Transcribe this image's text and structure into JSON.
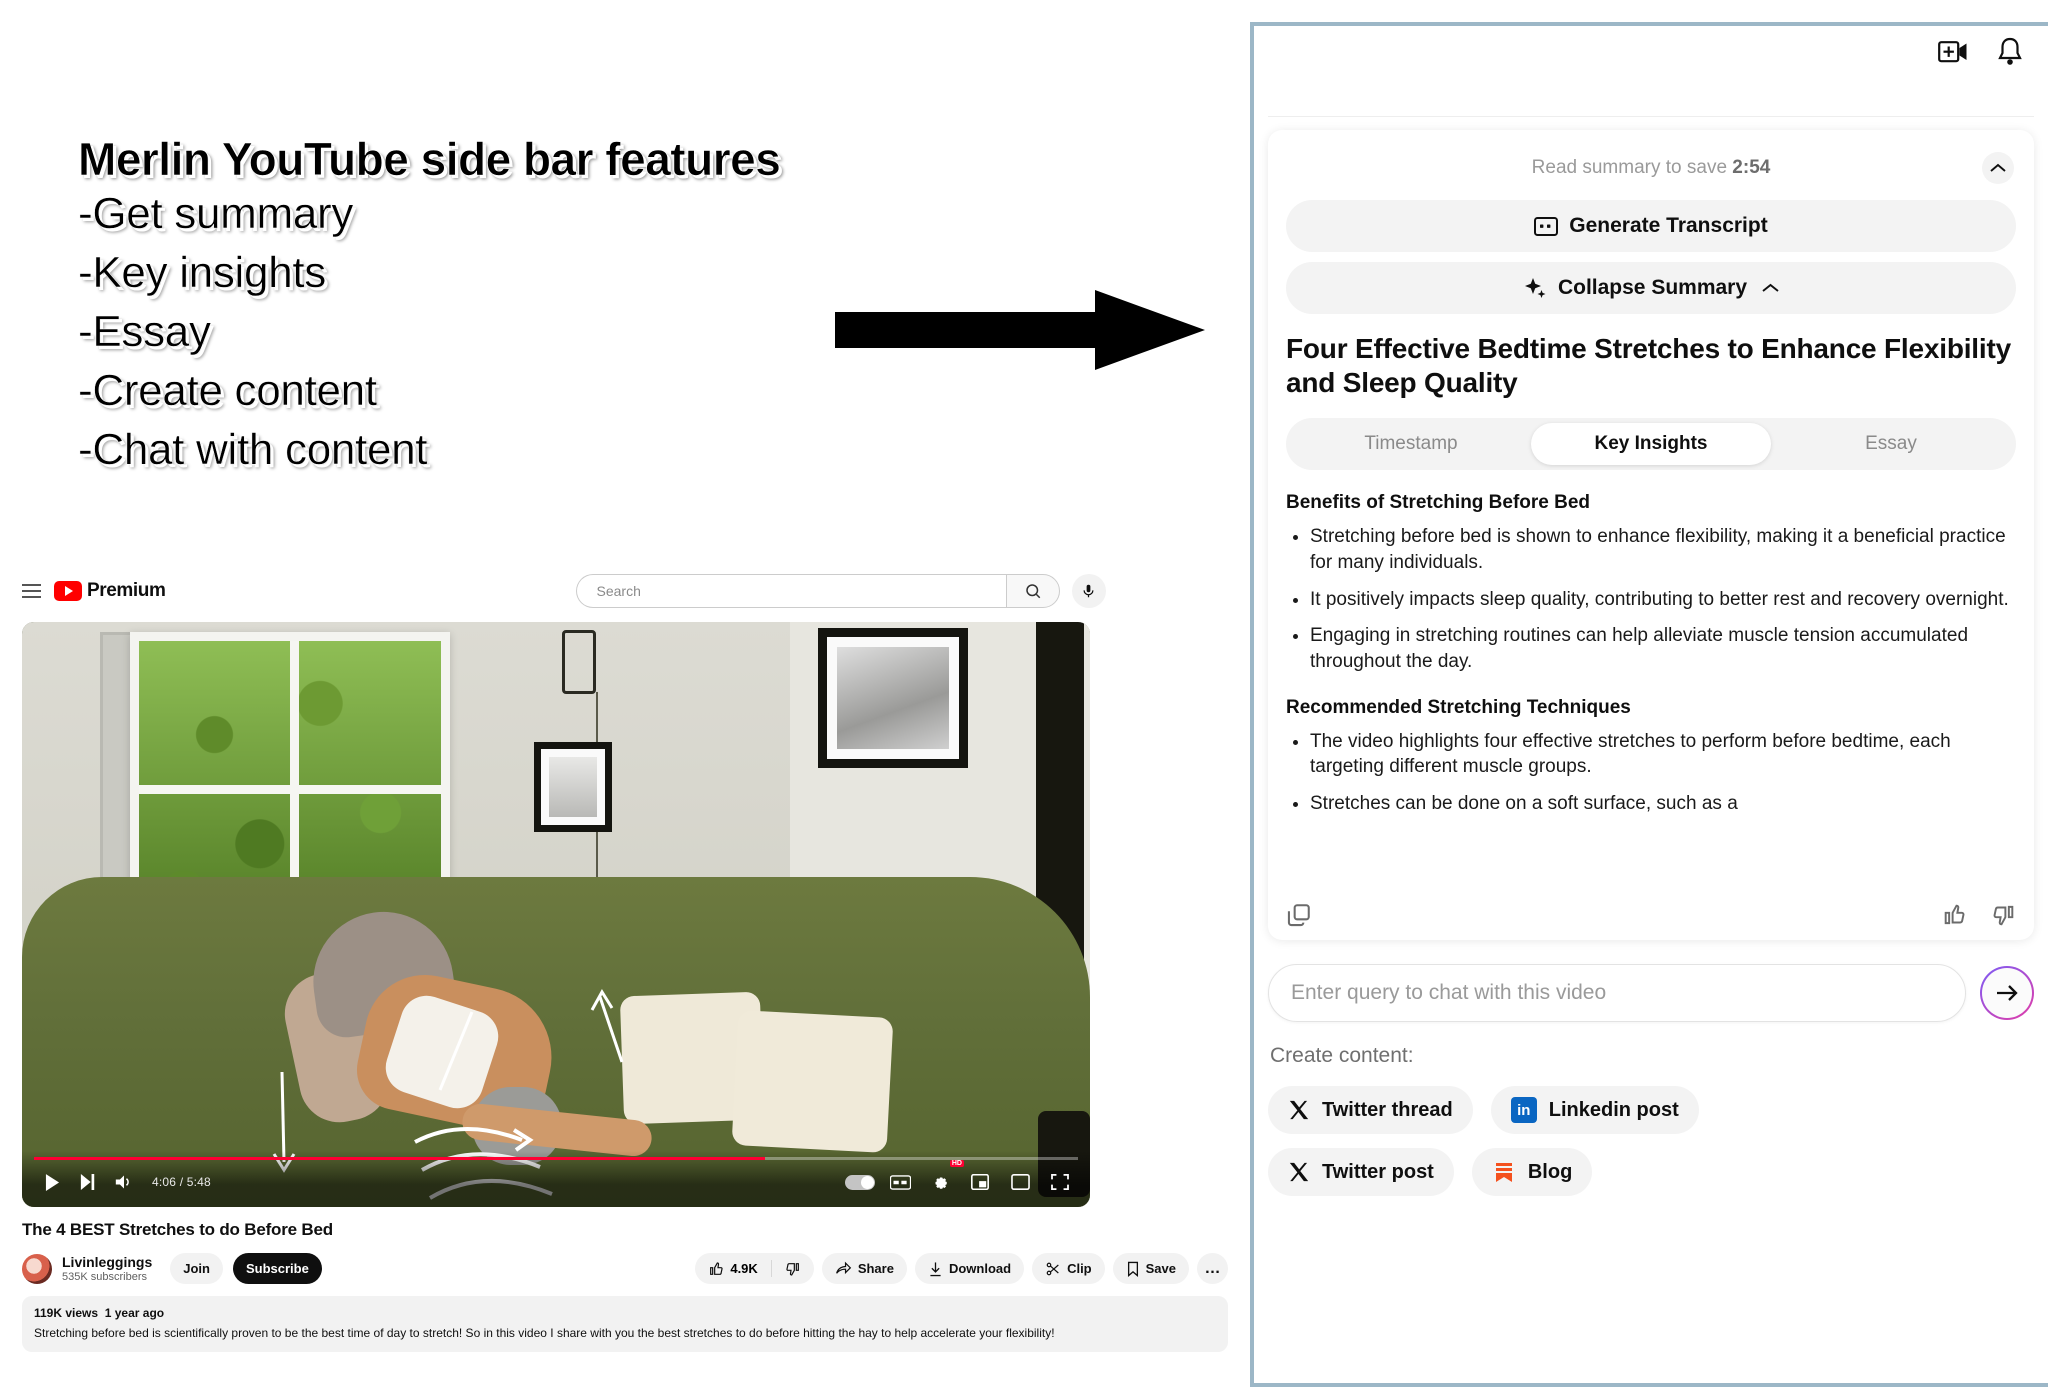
{
  "annotation": {
    "title": "Merlin YouTube side bar features",
    "lines": [
      "-Get summary",
      "-Key insights",
      "-Essay",
      "-Create content",
      "-Chat with content"
    ],
    "arrow_icon": "right-arrow-icon"
  },
  "youtube": {
    "brand": "Premium",
    "menu_icon": "hamburger-menu-icon",
    "logo_icon": "youtube-logo-icon",
    "search": {
      "placeholder": "Search",
      "search_icon": "search-icon",
      "mic_icon": "microphone-icon"
    },
    "player": {
      "current_time": "4:06",
      "duration": "5:48",
      "time_display": "4:06 / 5:48",
      "progress_percent": 70,
      "play_icon": "play-icon",
      "next_icon": "next-track-icon",
      "volume_icon": "volume-icon",
      "autoplay_icon": "autoplay-toggle-icon",
      "captions_icon": "closed-captions-icon",
      "settings_icon": "gear-icon",
      "quality_badge": "HD",
      "miniplayer_icon": "miniplayer-icon",
      "theater_icon": "theater-mode-icon",
      "fullscreen_icon": "fullscreen-icon"
    },
    "video": {
      "title": "The 4 BEST Stretches to do Before Bed",
      "channel": "Livinleggings",
      "subscribers": "535K subscribers",
      "join_label": "Join",
      "subscribe_label": "Subscribe",
      "like_count": "4.9K",
      "like_icon": "thumbs-up-icon",
      "dislike_icon": "thumbs-down-icon",
      "share_label": "Share",
      "share_icon": "share-icon",
      "download_label": "Download",
      "download_icon": "download-icon",
      "clip_label": "Clip",
      "clip_icon": "scissors-icon",
      "save_label": "Save",
      "save_icon": "bookmark-icon",
      "more_label": "…",
      "views": "119K views",
      "age": "1 year ago",
      "description": "Stretching before bed is scientifically proven to be the best time of day to stretch! So in this video I share with you the best stretches to do before hitting the hay to help accelerate your flexibility!"
    }
  },
  "merlin": {
    "topbar": {
      "add_video_icon": "add-to-video-icon",
      "bell_icon": "notification-bell-icon"
    },
    "read_summary_prefix": "Read summary to save ",
    "read_summary_time": "2:54",
    "collapse_chevron_icon": "chevron-up-icon",
    "generate_transcript_label": "Generate Transcript",
    "transcript_icon": "transcript-icon",
    "collapse_summary_label": "Collapse Summary",
    "sparkle_icon": "sparkle-icon",
    "collapse_summary_chevron_icon": "chevron-up-icon",
    "summary_title": "Four Effective Bedtime Stretches to Enhance Flexibility and Sleep Quality",
    "tabs": [
      {
        "label": "Timestamp",
        "active": false
      },
      {
        "label": "Key Insights",
        "active": true
      },
      {
        "label": "Essay",
        "active": false
      }
    ],
    "sections": [
      {
        "heading": "Benefits of Stretching Before Bed",
        "bullets": [
          "Stretching before bed is shown to enhance flexibility, making it a beneficial practice for many individuals.",
          "It positively impacts sleep quality, contributing to better rest and recovery overnight.",
          "Engaging in stretching routines can help alleviate muscle tension accumulated throughout the day."
        ]
      },
      {
        "heading": "Recommended Stretching Techniques",
        "bullets": [
          "The video highlights four effective stretches to perform before bedtime, each targeting different muscle groups.",
          "Stretches can be done on a soft surface, such as a"
        ]
      }
    ],
    "feedback": {
      "copy_icon": "copy-icon",
      "thumbs_up_icon": "thumbs-up-icon",
      "thumbs_down_icon": "thumbs-down-icon"
    },
    "chat": {
      "placeholder": "Enter query to chat with this video",
      "send_icon": "arrow-right-icon",
      "value": ""
    },
    "create_content_label": "Create content:",
    "create_buttons": [
      {
        "label": "Twitter thread",
        "icon": "x-twitter-icon"
      },
      {
        "label": "Linkedin post",
        "icon": "linkedin-icon"
      },
      {
        "label": "Twitter post",
        "icon": "x-twitter-icon"
      },
      {
        "label": "Blog",
        "icon": "blog-bookmark-icon"
      }
    ]
  },
  "colors": {
    "youtube_red": "#ff0000",
    "progress_red": "#ff0033",
    "sidebar_border": "#9cb7c7",
    "linkedin_blue": "#0a66c2",
    "blog_orange": "#f4511e",
    "send_gradient_from": "#7c5cf5",
    "send_gradient_to": "#e23ca8"
  }
}
